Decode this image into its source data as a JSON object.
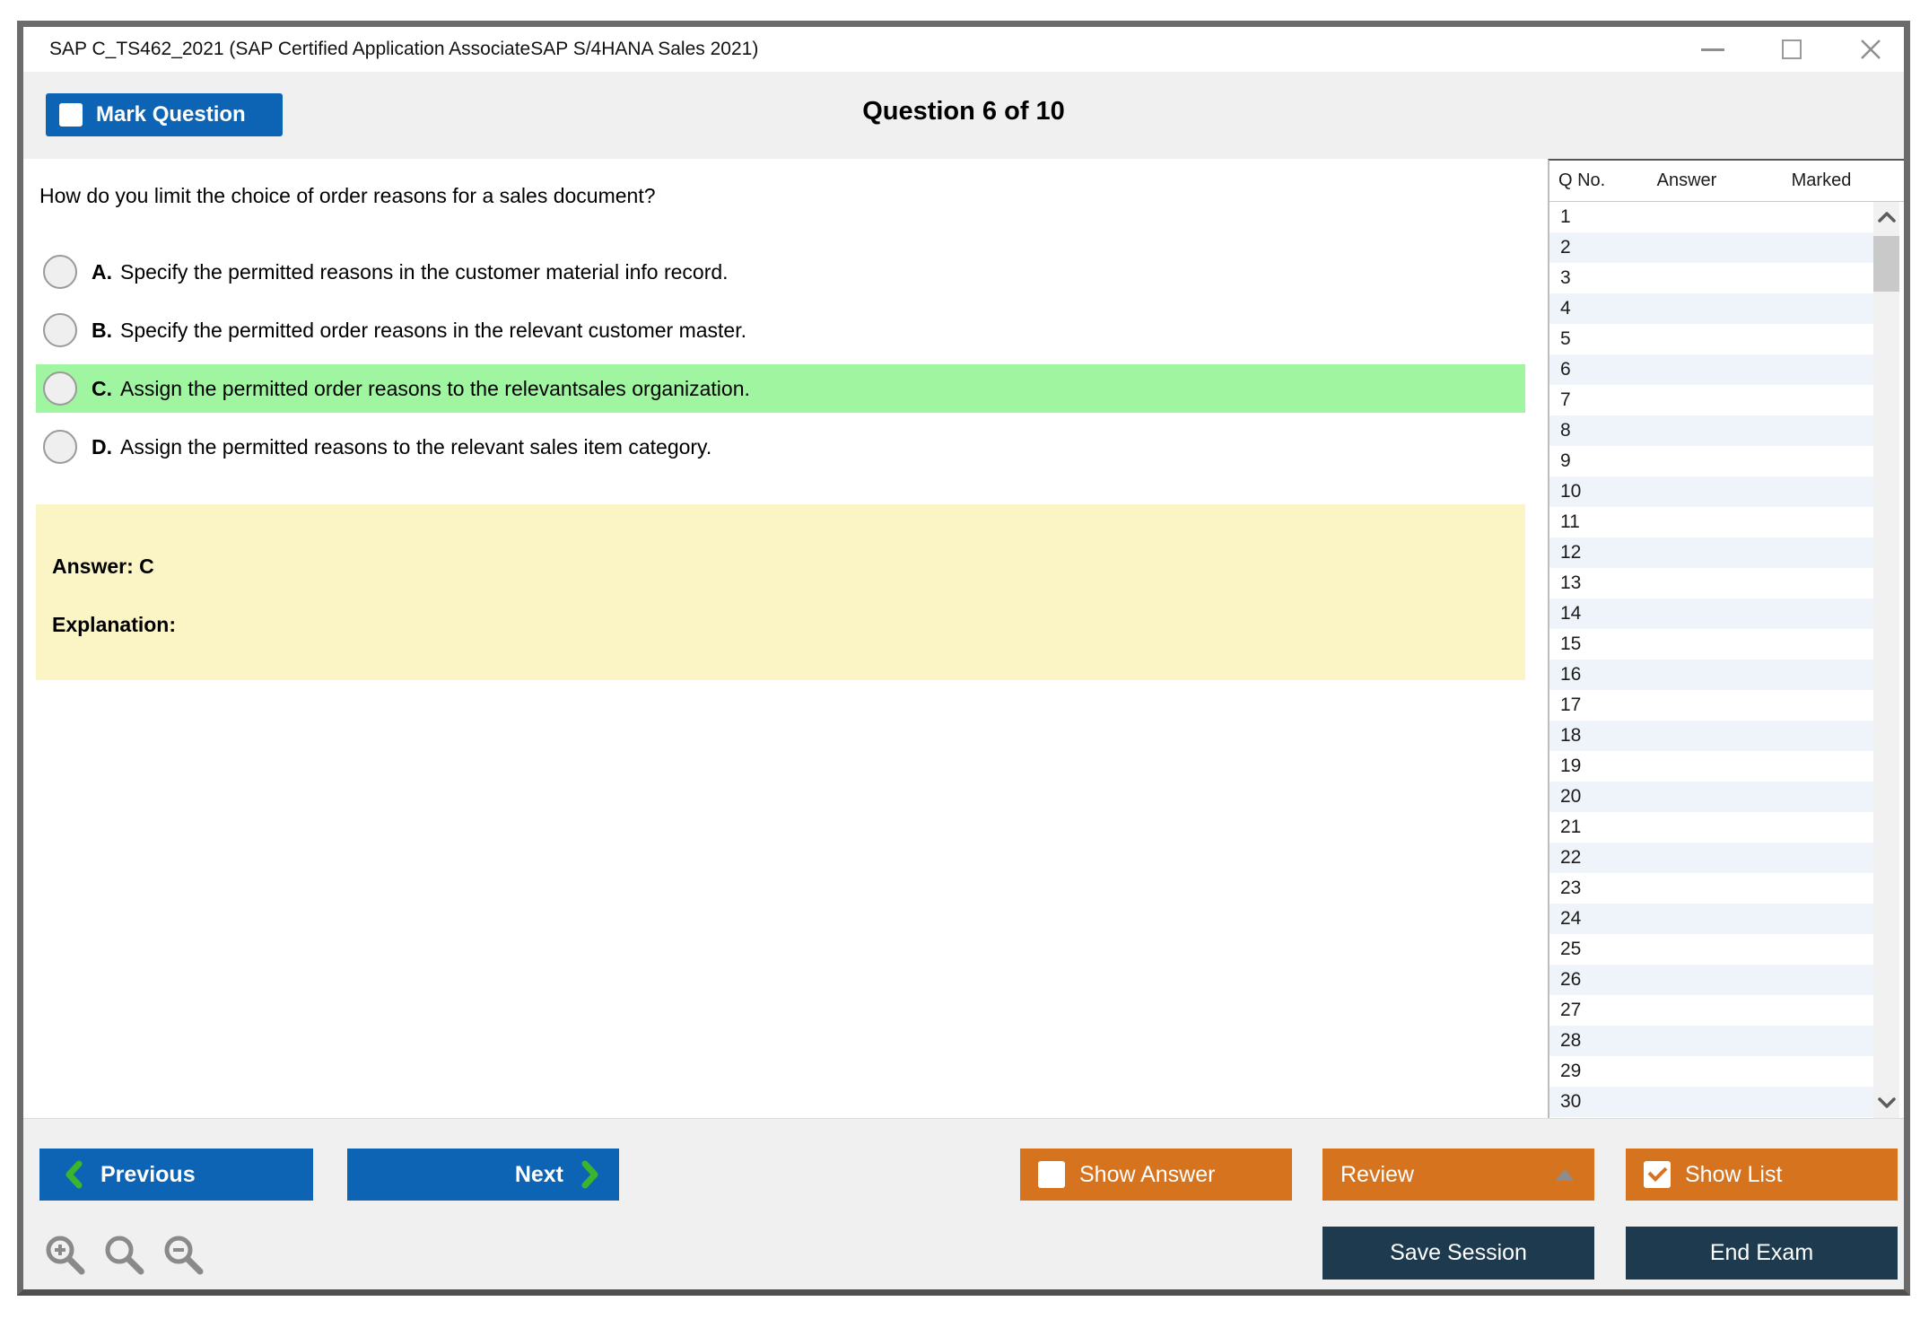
{
  "window": {
    "title": "SAP C_TS462_2021 (SAP Certified Application AssociateSAP S/4HANA Sales 2021)"
  },
  "header": {
    "mark_question_label": "Mark Question",
    "question_counter": "Question 6 of 10"
  },
  "question": {
    "text": "How do you limit the choice of order reasons for a sales document?",
    "options": [
      {
        "letter": "A.",
        "text": "Specify the permitted reasons in the customer material info record.",
        "highlighted": false
      },
      {
        "letter": "B.",
        "text": "Specify the permitted order reasons in the relevant customer master.",
        "highlighted": false
      },
      {
        "letter": "C.",
        "text": "Assign the permitted order reasons to the relevantsales organization.",
        "highlighted": true
      },
      {
        "letter": "D.",
        "text": "Assign the permitted reasons to the relevant sales item category.",
        "highlighted": false
      }
    ]
  },
  "answer_panel": {
    "answer_label": "Answer: C",
    "explanation_label": "Explanation:"
  },
  "question_list": {
    "columns": {
      "q_no": "Q No.",
      "answer": "Answer",
      "marked": "Marked"
    },
    "rows": [
      "1",
      "2",
      "3",
      "4",
      "5",
      "6",
      "7",
      "8",
      "9",
      "10",
      "11",
      "12",
      "13",
      "14",
      "15",
      "16",
      "17",
      "18",
      "19",
      "20",
      "21",
      "22",
      "23",
      "24",
      "25",
      "26",
      "27",
      "28",
      "29",
      "30"
    ]
  },
  "footer": {
    "previous_label": "Previous",
    "next_label": "Next",
    "show_answer_label": "Show Answer",
    "show_answer_checked": false,
    "review_label": "Review",
    "show_list_label": "Show List",
    "show_list_checked": true,
    "save_session_label": "Save Session",
    "end_exam_label": "End Exam"
  },
  "icons": {
    "window": [
      "minimize-icon",
      "maximize-icon",
      "close-icon"
    ],
    "navigation": [
      "chevron-left-icon",
      "chevron-right-icon"
    ],
    "review": "triangle-up-icon",
    "scrollbar": [
      "chevron-up-icon",
      "chevron-down-icon"
    ],
    "zoom": [
      "zoom-in-icon",
      "search-icon",
      "zoom-out-icon"
    ]
  },
  "colors": {
    "accent_blue": "#0e64b4",
    "accent_orange": "#d6731e",
    "dark_navy": "#1e3a4f",
    "highlight_green": "#a0f5a0",
    "answer_yellow": "#fbf5c6",
    "row_alt_blue": "#eef4f9",
    "chevron_green": "#3cb52e",
    "header_band_gray": "#f0f0f0"
  }
}
